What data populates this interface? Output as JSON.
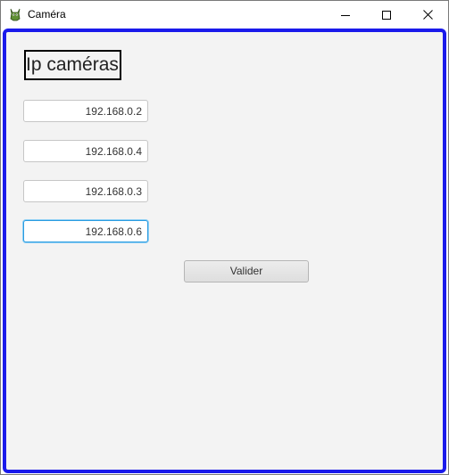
{
  "window": {
    "title": "Caméra",
    "app_icon": "android-icon",
    "controls": {
      "minimize": "minimize-icon",
      "maximize": "maximize-icon",
      "close": "close-icon"
    }
  },
  "form": {
    "heading": "Ip caméras",
    "fields": [
      {
        "value": "192.168.0.2",
        "focused": false
      },
      {
        "value": "192.168.0.4",
        "focused": false
      },
      {
        "value": "192.168.0.3",
        "focused": false
      },
      {
        "value": "192.168.0.6",
        "focused": true
      }
    ],
    "submit_label": "Valider"
  },
  "colors": {
    "accent_border": "#1a1aeb",
    "focus_border": "#2a9be0",
    "content_background": "#f3f3f3",
    "app_icon_green": "#6a9a3a"
  }
}
